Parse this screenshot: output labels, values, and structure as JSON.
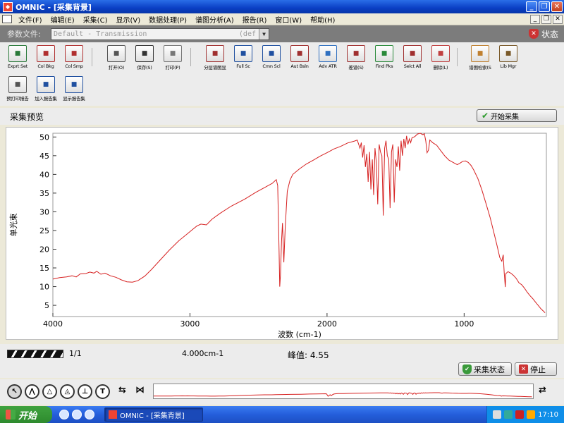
{
  "window": {
    "app_icon": "omnic-icon",
    "title": "OMNIC - [采集背景]",
    "buttons": [
      "_",
      "❐",
      "✕"
    ]
  },
  "menubar": {
    "items": [
      "文件(F)",
      "编辑(E)",
      "采集(C)",
      "显示(V)",
      "数据处理(P)",
      "谱图分析(A)",
      "报告(R)",
      "窗口(W)",
      "帮助(H)"
    ],
    "mdi_buttons": [
      "_",
      "❐",
      "✕"
    ]
  },
  "parambar": {
    "label": "参数文件:",
    "value": "Default - Transmission",
    "suffix": "(def",
    "status_label": "状态"
  },
  "toolbar": {
    "row1": [
      {
        "label": "Exprt Set",
        "icon": "export-settings-icon",
        "color": "#2a7a3a"
      },
      {
        "label": "Col Bkg",
        "icon": "collect-background-icon",
        "color": "#b03030"
      },
      {
        "label": "Col Smp",
        "icon": "collect-sample-icon",
        "color": "#b03030"
      },
      {
        "label": "打开(O)",
        "icon": "open-icon",
        "color": "#555555"
      },
      {
        "label": "保存(S)",
        "icon": "save-icon",
        "color": "#333333"
      },
      {
        "label": "打印(P)",
        "icon": "print-icon",
        "color": "#777777"
      },
      {
        "label": "分层谱图显",
        "icon": "stack-spectra-icon",
        "color": "#a03030"
      },
      {
        "label": "Full Sc",
        "icon": "full-scale-icon",
        "color": "#2050a0"
      },
      {
        "label": "Cmn Scl",
        "icon": "common-scale-icon",
        "color": "#2050a0"
      },
      {
        "label": "Aut Bsln",
        "icon": "auto-baseline-icon",
        "color": "#a03030"
      },
      {
        "label": "Adv ATR",
        "icon": "advanced-atr-icon",
        "color": "#3070c0"
      },
      {
        "label": "差谱(S)",
        "icon": "subtract-icon",
        "color": "#a03030"
      },
      {
        "label": "Find Pks",
        "icon": "find-peaks-icon",
        "color": "#2a8a3a"
      },
      {
        "label": "Selct All",
        "icon": "select-all-icon",
        "color": "#a03030"
      },
      {
        "label": "删除(L)",
        "icon": "delete-icon",
        "color": "#c04040"
      },
      {
        "label": "谱图检索(S",
        "icon": "spectral-search-icon",
        "color": "#c08030"
      },
      {
        "label": "Lib Mgr",
        "icon": "library-manager-icon",
        "color": "#7a5a2a"
      }
    ],
    "row2": [
      {
        "label": "预打印报告",
        "icon": "print-preview-report-icon",
        "color": "#555555"
      },
      {
        "label": "加入报告集",
        "icon": "add-to-report-icon",
        "color": "#2050a0"
      },
      {
        "label": "显示报告集",
        "icon": "show-report-icon",
        "color": "#2050a0"
      }
    ]
  },
  "preview": {
    "title": "采集预览",
    "start_button": "开始采集"
  },
  "chart_data": {
    "type": "line",
    "title": "",
    "xlabel": "波数 (cm-1)",
    "ylabel": "单光束",
    "xlim": [
      4000,
      400
    ],
    "ylim": [
      2,
      51
    ],
    "x_ticks": [
      4000,
      3000,
      2000,
      1000
    ],
    "y_ticks": [
      5,
      10,
      15,
      20,
      25,
      30,
      35,
      40,
      45,
      50
    ],
    "color": "#d62020",
    "series": [
      {
        "points": [
          [
            4000,
            12.0
          ],
          [
            3950,
            12.4
          ],
          [
            3900,
            12.6
          ],
          [
            3860,
            12.9
          ],
          [
            3830,
            12.6
          ],
          [
            3800,
            13.4
          ],
          [
            3760,
            13.5
          ],
          [
            3730,
            13.9
          ],
          [
            3700,
            13.6
          ],
          [
            3680,
            14.1
          ],
          [
            3650,
            13.3
          ],
          [
            3620,
            13.6
          ],
          [
            3580,
            12.9
          ],
          [
            3540,
            12.5
          ],
          [
            3500,
            11.8
          ],
          [
            3460,
            11.3
          ],
          [
            3420,
            11.2
          ],
          [
            3380,
            11.6
          ],
          [
            3330,
            12.8
          ],
          [
            3280,
            14.6
          ],
          [
            3220,
            17.0
          ],
          [
            3150,
            19.8
          ],
          [
            3080,
            22.3
          ],
          [
            3020,
            24.1
          ],
          [
            2980,
            25.3
          ],
          [
            2950,
            26.2
          ],
          [
            2920,
            26.7
          ],
          [
            2880,
            26.5
          ],
          [
            2840,
            28.0
          ],
          [
            2780,
            29.6
          ],
          [
            2700,
            31.5
          ],
          [
            2600,
            33.4
          ],
          [
            2520,
            35.2
          ],
          [
            2450,
            36.6
          ],
          [
            2400,
            37.6
          ],
          [
            2370,
            38.6
          ],
          [
            2360,
            37.0
          ],
          [
            2350,
            20.0
          ],
          [
            2345,
            10.0
          ],
          [
            2340,
            13.0
          ],
          [
            2332,
            22.0
          ],
          [
            2325,
            27.0
          ],
          [
            2315,
            16.5
          ],
          [
            2305,
            26.0
          ],
          [
            2290,
            35.5
          ],
          [
            2270,
            38.5
          ],
          [
            2250,
            40.0
          ],
          [
            2200,
            41.5
          ],
          [
            2150,
            42.8
          ],
          [
            2100,
            43.8
          ],
          [
            2050,
            44.9
          ],
          [
            2000,
            45.8
          ],
          [
            1950,
            46.8
          ],
          [
            1900,
            47.5
          ],
          [
            1850,
            48.4
          ],
          [
            1800,
            48.9
          ],
          [
            1780,
            49.2
          ],
          [
            1760,
            47.0
          ],
          [
            1750,
            48.5
          ],
          [
            1740,
            44.5
          ],
          [
            1730,
            47.8
          ],
          [
            1720,
            42.0
          ],
          [
            1710,
            45.5
          ],
          [
            1700,
            38.0
          ],
          [
            1690,
            46.0
          ],
          [
            1680,
            36.0
          ],
          [
            1670,
            44.0
          ],
          [
            1660,
            34.5
          ],
          [
            1650,
            47.0
          ],
          [
            1640,
            43.0
          ],
          [
            1630,
            32.0
          ],
          [
            1620,
            48.0
          ],
          [
            1610,
            46.0
          ],
          [
            1600,
            45.0
          ],
          [
            1590,
            29.0
          ],
          [
            1580,
            47.0
          ],
          [
            1570,
            49.0
          ],
          [
            1560,
            45.0
          ],
          [
            1550,
            44.0
          ],
          [
            1540,
            31.0
          ],
          [
            1530,
            46.0
          ],
          [
            1520,
            48.0
          ],
          [
            1510,
            32.5
          ],
          [
            1500,
            44.0
          ],
          [
            1490,
            42.0
          ],
          [
            1480,
            47.5
          ],
          [
            1470,
            41.0
          ],
          [
            1460,
            49.0
          ],
          [
            1450,
            45.0
          ],
          [
            1440,
            49.5
          ],
          [
            1430,
            47.0
          ],
          [
            1420,
            50.3
          ],
          [
            1410,
            48.0
          ],
          [
            1400,
            49.5
          ],
          [
            1390,
            48.5
          ],
          [
            1380,
            49.8
          ],
          [
            1360,
            50.1
          ],
          [
            1340,
            50.8
          ],
          [
            1320,
            51.0
          ],
          [
            1300,
            50.6
          ],
          [
            1290,
            50.9
          ],
          [
            1280,
            49.0
          ],
          [
            1270,
            45.8
          ],
          [
            1260,
            46.5
          ],
          [
            1250,
            49.2
          ],
          [
            1230,
            48.5
          ],
          [
            1200,
            47.8
          ],
          [
            1170,
            46.3
          ],
          [
            1140,
            44.9
          ],
          [
            1110,
            43.8
          ],
          [
            1080,
            43.2
          ],
          [
            1050,
            42.6
          ],
          [
            1030,
            43.0
          ],
          [
            1010,
            43.5
          ],
          [
            990,
            43.6
          ],
          [
            970,
            43.2
          ],
          [
            950,
            42.4
          ],
          [
            930,
            41.2
          ],
          [
            900,
            38.9
          ],
          [
            870,
            35.8
          ],
          [
            840,
            32.2
          ],
          [
            810,
            28.4
          ],
          [
            780,
            24.0
          ],
          [
            760,
            21.0
          ],
          [
            740,
            17.8
          ],
          [
            725,
            16.8
          ],
          [
            715,
            18.5
          ],
          [
            708,
            14.0
          ],
          [
            700,
            9.9
          ],
          [
            695,
            13.5
          ],
          [
            680,
            14.0
          ],
          [
            660,
            13.6
          ],
          [
            640,
            13.0
          ],
          [
            620,
            12.2
          ],
          [
            600,
            11.0
          ],
          [
            580,
            10.5
          ],
          [
            560,
            9.6
          ],
          [
            540,
            8.5
          ],
          [
            520,
            7.6
          ],
          [
            500,
            6.8
          ],
          [
            480,
            5.9
          ],
          [
            460,
            5.0
          ],
          [
            440,
            4.1
          ],
          [
            420,
            3.4
          ],
          [
            410,
            3.0
          ]
        ]
      }
    ]
  },
  "status": {
    "scan_count": "1/1",
    "resolution": "4.000cm-1",
    "peak": "峰值: 4.55"
  },
  "acquire": {
    "status_button": "采集状态",
    "stop_button": "停止"
  },
  "taskbar": {
    "start_label": "开始",
    "task_label": "OMNIC - [采集背景]",
    "clock": "17:10"
  }
}
